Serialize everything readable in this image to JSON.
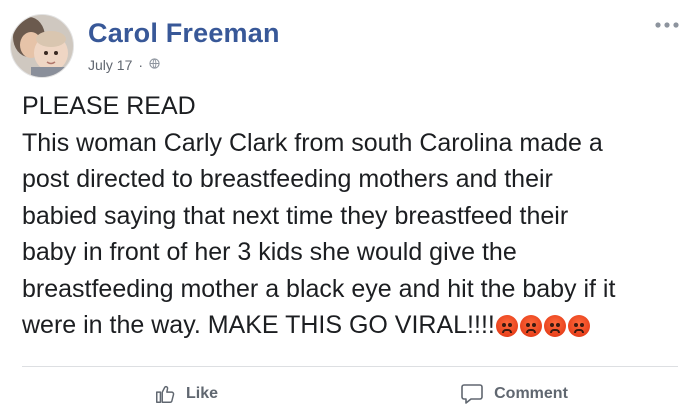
{
  "post": {
    "author": "Carol Freeman",
    "date": "July 17",
    "date_separator": "·",
    "more_icon": "more-horizontal-icon",
    "body_lines": [
      "PLEASE READ",
      "This woman Carly Clark from south Carolina made a",
      "post directed to breastfeeding mothers and their",
      "babied saying that next time they breastfeed their",
      "baby in front of her 3 kids she would give the",
      "breastfeeding mother a black eye and hit the baby if it",
      "were in the way. MAKE THIS GO VIRAL!!!!"
    ],
    "emoji_count": 4,
    "emoji_icon": "angry-face-icon"
  },
  "actions": {
    "like_label": "Like",
    "comment_label": "Comment"
  },
  "colors": {
    "author": "#385898",
    "text": "#1c1e21",
    "meta": "#616770",
    "action": "#606770"
  }
}
